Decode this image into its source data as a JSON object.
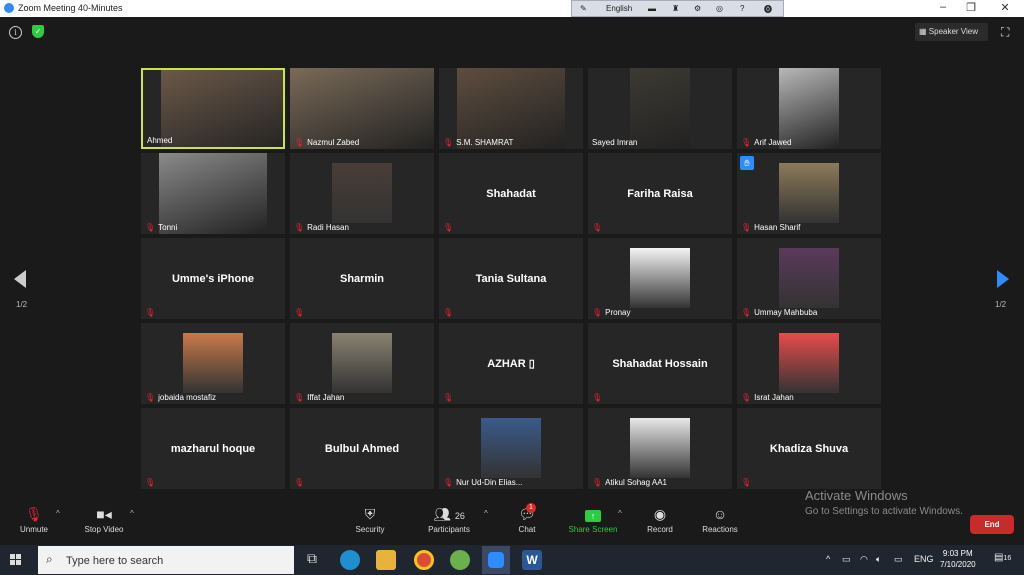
{
  "window": {
    "title": "Zoom Meeting 40-Minutes"
  },
  "langbar": {
    "language": "English"
  },
  "header": {
    "speaker_view": "Speaker View"
  },
  "tiles": [
    {
      "name": "Ahmed",
      "kind": "video",
      "active": true,
      "muted": false
    },
    {
      "name": "Nazmul Zabed",
      "kind": "video",
      "muted": true
    },
    {
      "name": "S.M. SHAMRAT",
      "kind": "video",
      "muted": true
    },
    {
      "name": "Sayed Imran",
      "kind": "video",
      "muted": false
    },
    {
      "name": "Arif Jawed",
      "kind": "video",
      "muted": true
    },
    {
      "name": "Tonni",
      "kind": "video",
      "muted": true
    },
    {
      "name": "Radi Hasan",
      "kind": "photo",
      "muted": true
    },
    {
      "name": "Shahadat",
      "kind": "name",
      "muted": true
    },
    {
      "name": "Fariha Raisa",
      "kind": "name",
      "muted": true
    },
    {
      "name": "Hasan Sharif",
      "kind": "photo",
      "muted": true,
      "raised_hand": true
    },
    {
      "name": "Umme's iPhone",
      "kind": "name",
      "muted": true
    },
    {
      "name": "Sharmin",
      "kind": "name",
      "muted": true
    },
    {
      "name": "Tania Sultana",
      "kind": "name",
      "muted": true
    },
    {
      "name": "Pronay",
      "kind": "photo",
      "muted": true
    },
    {
      "name": "Ummay Mahbuba",
      "kind": "photo",
      "muted": true
    },
    {
      "name": "jobaida mostafiz",
      "kind": "photo",
      "muted": true
    },
    {
      "name": "Iffat Jahan",
      "kind": "photo",
      "muted": true
    },
    {
      "name": "AZHAR ▯",
      "kind": "name",
      "muted": true
    },
    {
      "name": "Shahadat Hossain",
      "kind": "name",
      "muted": true
    },
    {
      "name": "Israt Jahan",
      "kind": "photo",
      "muted": true
    },
    {
      "name": "mazharul hoque",
      "kind": "name",
      "muted": true
    },
    {
      "name": "Bulbul Ahmed",
      "kind": "name",
      "muted": true
    },
    {
      "name": "Nur Ud-Din Elias...",
      "kind": "photo",
      "muted": true
    },
    {
      "name": "Atikul Sohag AA1",
      "kind": "photo",
      "muted": true
    },
    {
      "name": "Khadiza Shuva",
      "kind": "name",
      "muted": true
    }
  ],
  "pagination": {
    "left": "1/2",
    "right": "1/2"
  },
  "toolbar": {
    "unmute": "Unmute",
    "stop_video": "Stop Video",
    "security": "Security",
    "participants": "Participants",
    "participants_count": "26",
    "chat": "Chat",
    "chat_badge": "1",
    "share_screen": "Share Screen",
    "record": "Record",
    "reactions": "Reactions",
    "end": "End"
  },
  "watermark": {
    "line1": "Activate Windows",
    "line2": "Go to Settings to activate Windows."
  },
  "taskbar": {
    "search_placeholder": "Type here to search",
    "lang": "ENG",
    "time": "9:03 PM",
    "date": "7/10/2020",
    "notification_count": "16"
  },
  "colors": {
    "accent": "#2d8cff",
    "active_border": "#c8e63c",
    "end": "#c92a2a",
    "share": "#2ecc40"
  }
}
